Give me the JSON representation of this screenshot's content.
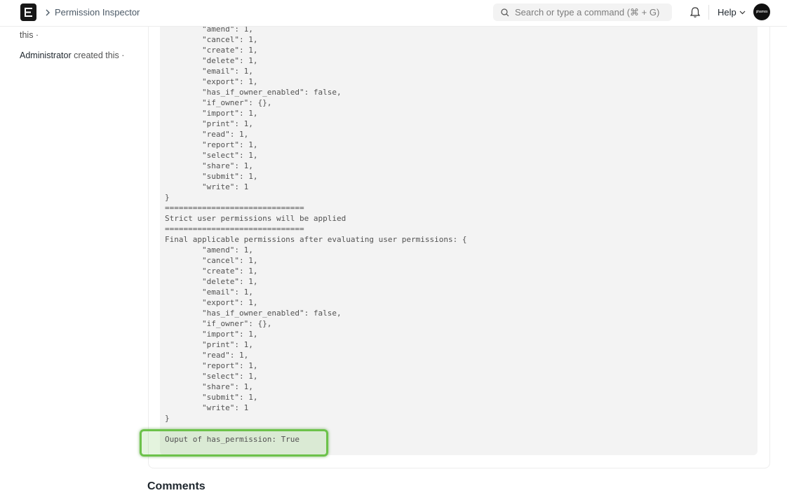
{
  "navbar": {
    "logo_letter": "E",
    "breadcrumb_title": "Permission Inspector",
    "search_placeholder": "Search or type a command (⌘ + G)",
    "help_label": "Help",
    "avatar_text": "phamos"
  },
  "sidebar": {
    "line1": "this ·",
    "line2_user": "Administrator",
    "line2_rest": " created this ·"
  },
  "code_lines": [
    "        \"amend\": 1,",
    "        \"cancel\": 1,",
    "        \"create\": 1,",
    "        \"delete\": 1,",
    "        \"email\": 1,",
    "        \"export\": 1,",
    "        \"has_if_owner_enabled\": false,",
    "        \"if_owner\": {},",
    "        \"import\": 1,",
    "        \"print\": 1,",
    "        \"read\": 1,",
    "        \"report\": 1,",
    "        \"select\": 1,",
    "        \"share\": 1,",
    "        \"submit\": 1,",
    "        \"write\": 1",
    "}",
    "==============================",
    "Strict user permissions will be applied",
    "==============================",
    "Final applicable permissions after evaluating user permissions: {",
    "        \"amend\": 1,",
    "        \"cancel\": 1,",
    "        \"create\": 1,",
    "        \"delete\": 1,",
    "        \"email\": 1,",
    "        \"export\": 1,",
    "        \"has_if_owner_enabled\": false,",
    "        \"if_owner\": {},",
    "        \"import\": 1,",
    "        \"print\": 1,",
    "        \"read\": 1,",
    "        \"report\": 1,",
    "        \"select\": 1,",
    "        \"share\": 1,",
    "        \"submit\": 1,",
    "        \"write\": 1",
    "}"
  ],
  "output_line": "Ouput of has_permission: True",
  "comments_heading": "Comments",
  "colors": {
    "highlight_border": "#6cc24a",
    "code_background": "#f3f3f3"
  }
}
